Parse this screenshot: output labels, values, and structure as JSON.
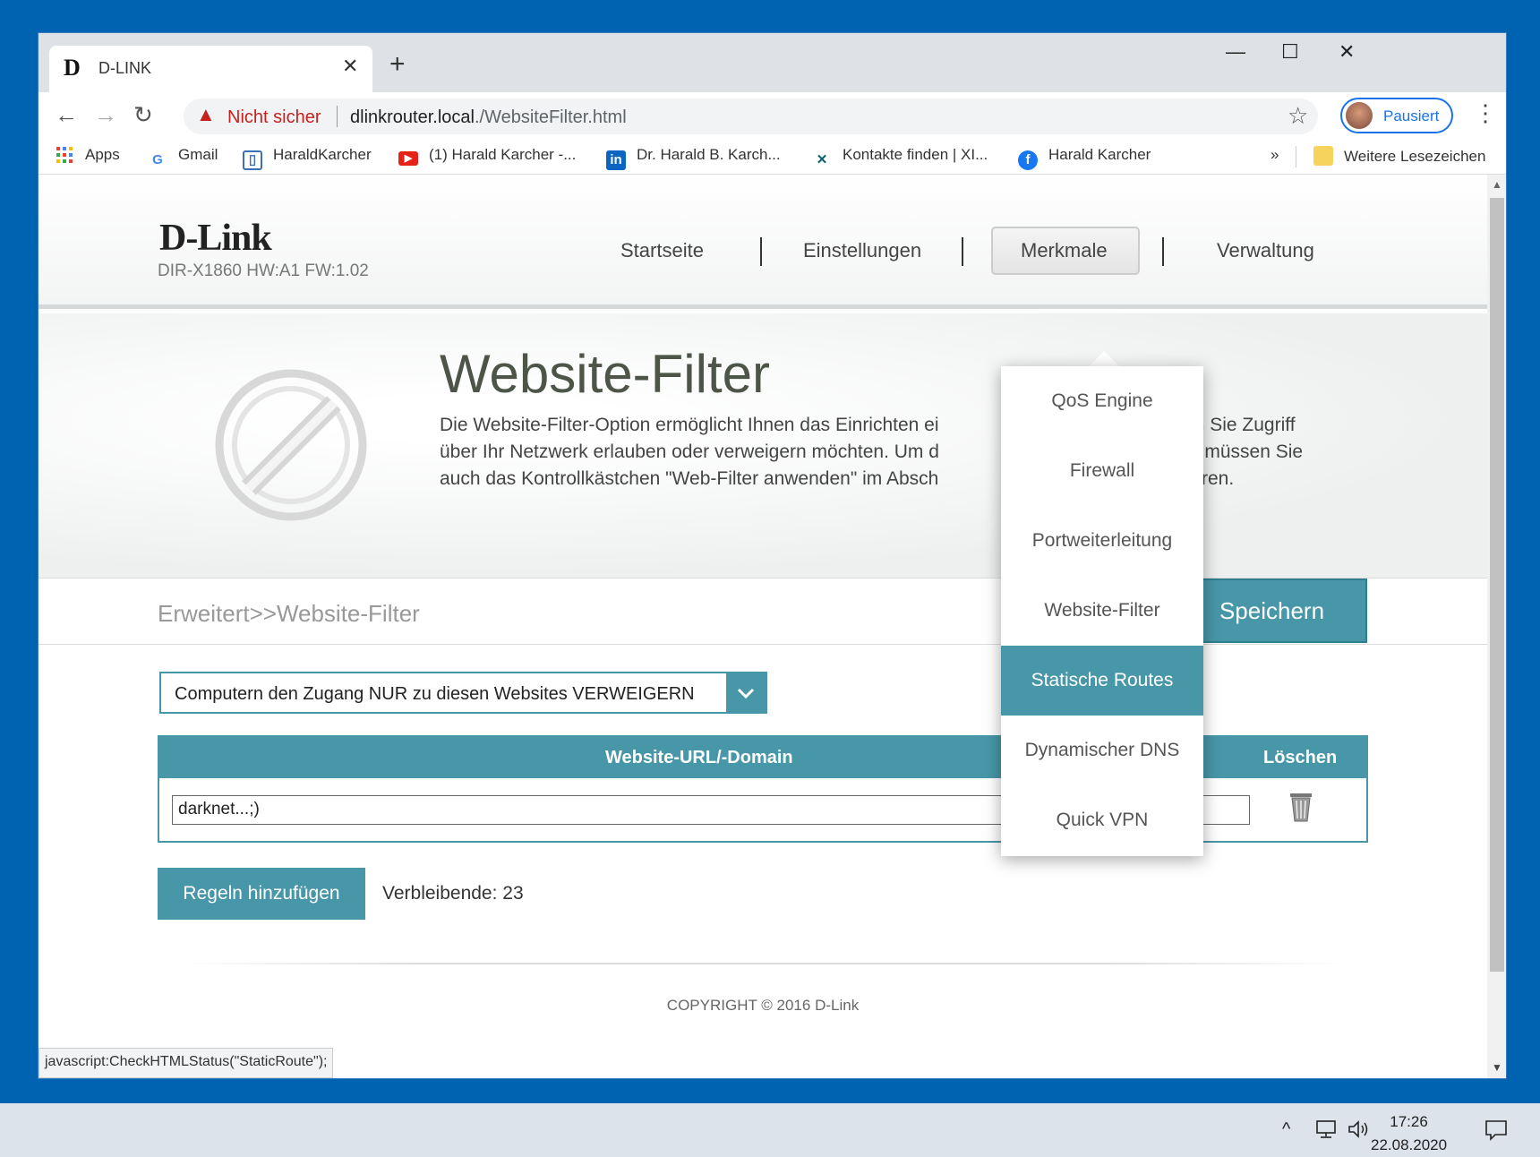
{
  "tab": {
    "favicon": "D",
    "title": "D-LINK",
    "close": "✕",
    "new": "+"
  },
  "window": {
    "minimize": "—",
    "maximize": "☐",
    "close": "✕"
  },
  "toolbar": {
    "back": "←",
    "forward": "→",
    "reload": "↻",
    "security_label": "Nicht sicher",
    "url_host": "dlinkrouter.local",
    "url_path": "./WebsiteFilter.html",
    "profile_label": "Pausiert"
  },
  "bookmarks": [
    {
      "label": "Apps",
      "icon": "apps-grid-icon"
    },
    {
      "label": "Gmail",
      "icon": "google-icon"
    },
    {
      "label": "HaraldKarcher",
      "icon": "page-icon"
    },
    {
      "label": "(1) Harald Karcher -...",
      "icon": "youtube-icon"
    },
    {
      "label": "Dr. Harald B. Karch...",
      "icon": "linkedin-icon"
    },
    {
      "label": "Kontakte finden | XI...",
      "icon": "xing-icon"
    },
    {
      "label": "Harald Karcher",
      "icon": "facebook-icon"
    }
  ],
  "bookmarks_more": "»",
  "bookmarks_other": "Weitere Lesezeichen",
  "router": {
    "logo": "D-Link",
    "model": "DIR-X1860 HW:A1 FW:1.02",
    "nav": [
      "Startseite",
      "Einstellungen",
      "Merkmale",
      "Verwaltung"
    ],
    "title": "Website-Filter",
    "description": "Die Website-Filter-Option ermöglicht Ihnen das Einrichten ei                                  denen Sie Zugriff über Ihr Netzwerk erlauben oder verweigern möchten. Um d                                  nden, müssen Sie auch das Kontrollkästchen \"Web-Filter anwenden\" im Absch                                  markieren.",
    "description_lines": [
      "Die Website-Filter-Option ermöglicht Ihnen das Einrichten ei",
      "über Ihr Netzwerk erlauben oder verweigern möchten. Um d",
      "auch das Kontrollkästchen \"Web-Filter anwenden\" im Absch"
    ],
    "description_right": [
      "denen Sie Zugriff",
      "nden, müssen Sie",
      "markieren."
    ],
    "breadcrumb": "Erweitert>>Website-Filter",
    "save": "Speichern",
    "filter_mode": "Computern den Zugang NUR zu diesen Websites VERWEIGERN",
    "table": {
      "col_url": "Website-URL/-Domain",
      "col_delete": "Löschen",
      "rows": [
        {
          "url": "darknet...;)"
        }
      ]
    },
    "add_rules": "Regeln hinzufügen",
    "remaining": "Verbleibende: 23",
    "copyright": "COPYRIGHT © 2016 D-Link"
  },
  "dropdown": {
    "items": [
      "QoS Engine",
      "Firewall",
      "Portweiterleitung",
      "Website-Filter",
      "Statische Routes",
      "Dynamischer DNS",
      "Quick VPN"
    ],
    "active_index": 4
  },
  "status_bar": "javascript:CheckHTMLStatus(\"StaticRoute\");",
  "taskbar": {
    "time": "17:26",
    "date": "22.08.2020"
  },
  "colors": {
    "accent": "#4897a9",
    "desktop": "#0063b1",
    "warning": "#c5221f"
  }
}
